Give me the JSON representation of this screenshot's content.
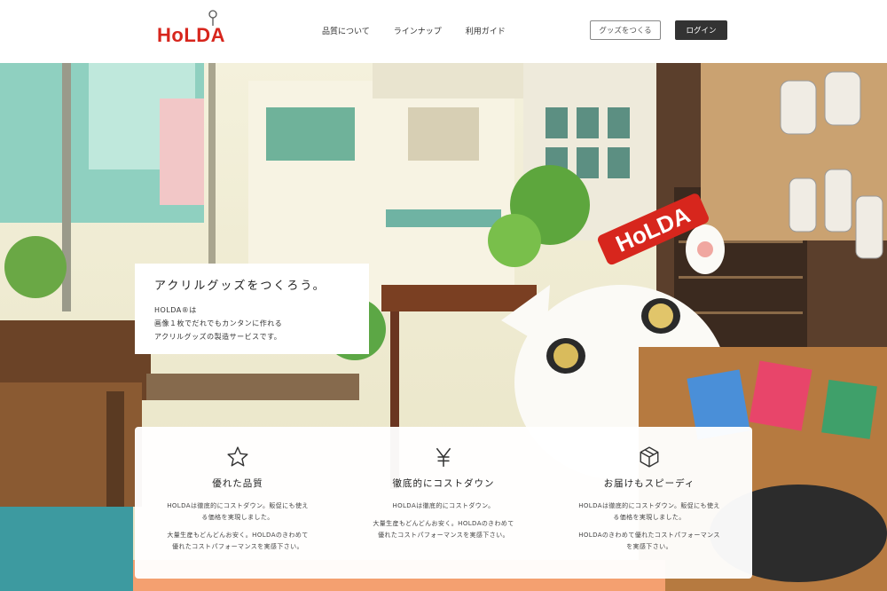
{
  "header": {
    "logo_text": "HoLDA",
    "nav": [
      "品質について",
      "ラインナップ",
      "利用ガイド"
    ],
    "make_goods_label": "グッズをつくる",
    "login_label": "ログイン"
  },
  "hero": {
    "title": "アクリルグッズをつくろう。",
    "lines": [
      "HOLDA®は",
      "画像１枚でだれでもカンタンに作れる",
      "アクリルグッズの製造サービスです。"
    ],
    "sign_text": "HoLDA"
  },
  "features": [
    {
      "icon": "star-icon",
      "title": "優れた品質",
      "para1": "HOLDAは徹底的にコストダウン。販促にも使える価格を実現しました。",
      "para2": "大量生産もどんどんお安く。HOLDAのきわめて優れたコストパフォーマンスを実感下さい。"
    },
    {
      "icon": "yen-icon",
      "title": "徹底的にコストダウン",
      "para1": "HOLDAは徹底的にコストダウン。",
      "para2": "大量生産もどんどんお安く。HOLDAのきわめて優れたコストパフォーマンスを実感下さい。"
    },
    {
      "icon": "box-icon",
      "title": "お届けもスピーディ",
      "para1": "HOLDAは徹底的にコストダウン。販促にも使える価格を実現しました。",
      "para2": "HOLDAのきわめて優れたコストパフォーマンスを実感下さい。"
    }
  ],
  "colors": {
    "brand_red": "#d7261d",
    "dark_button": "#333333"
  }
}
